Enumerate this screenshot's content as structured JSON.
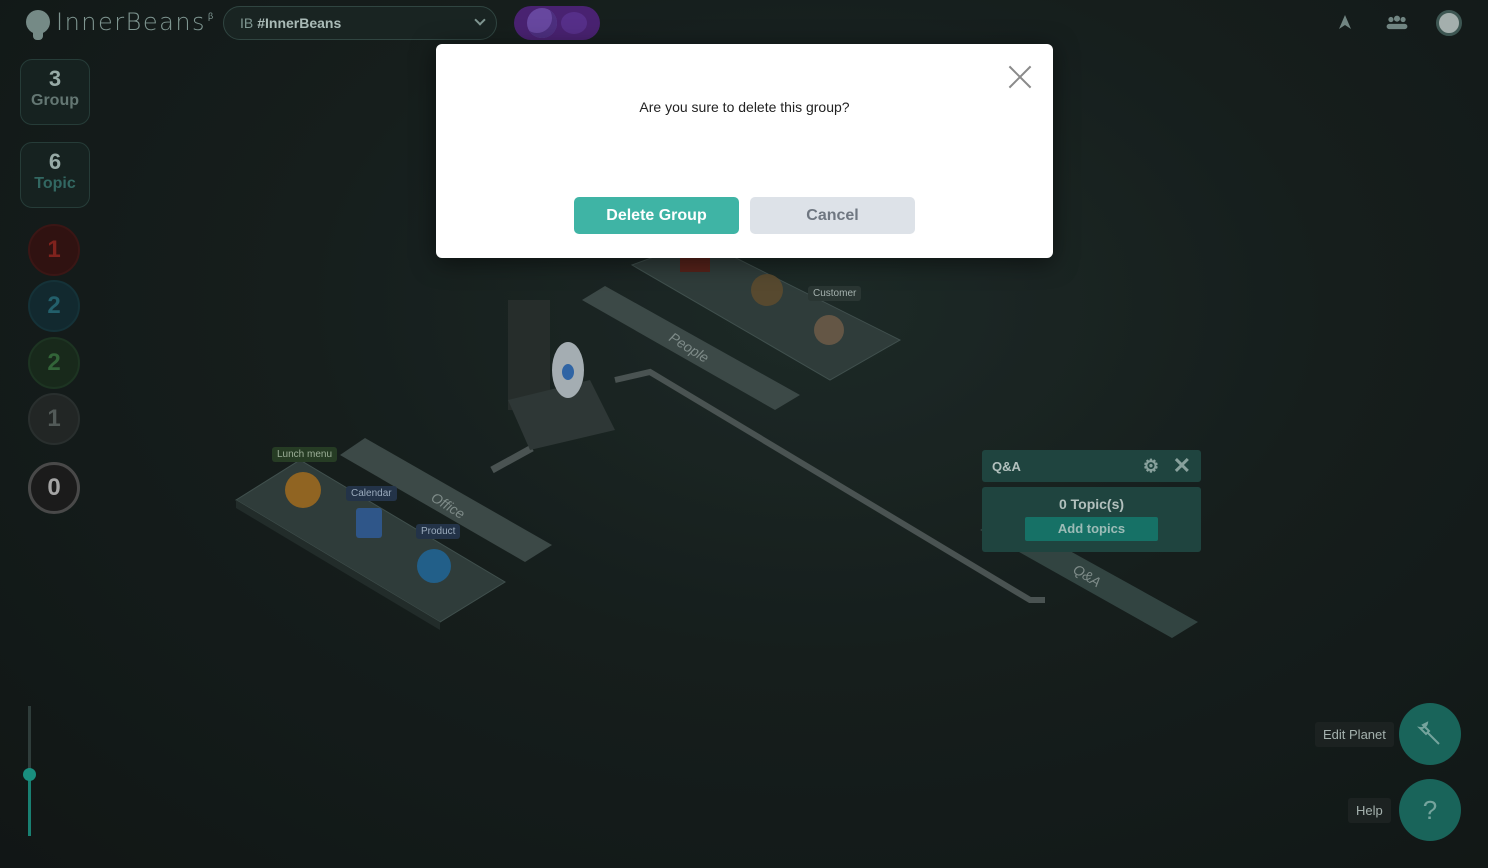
{
  "app": {
    "name": "InnerBeans",
    "beta": "β"
  },
  "workspace": {
    "prefix": "IB",
    "name": "#InnerBeans"
  },
  "rail": {
    "group": {
      "count": "3",
      "label": "Group"
    },
    "topic": {
      "count": "6",
      "label": "Topic"
    },
    "status": [
      "1",
      "2",
      "2",
      "1",
      "0"
    ]
  },
  "scene": {
    "platforms": [
      "Office",
      "People",
      "Q&A"
    ],
    "tags": {
      "lunch": "Lunch menu",
      "calendar": "Calendar",
      "product": "Product",
      "customer": "Customer"
    }
  },
  "qa_panel": {
    "title": "Q&A",
    "topics": "0 Topic(s)",
    "add": "Add topics"
  },
  "fab": {
    "edit": "Edit Planet",
    "help": "Help"
  },
  "modal": {
    "message": "Are you sure to delete this group?",
    "delete": "Delete Group",
    "cancel": "Cancel"
  },
  "zoom": {
    "level": 0.48
  },
  "colors": {
    "accent": "#3fb4a5",
    "panel": "#26544e",
    "background": "#1b2523"
  }
}
